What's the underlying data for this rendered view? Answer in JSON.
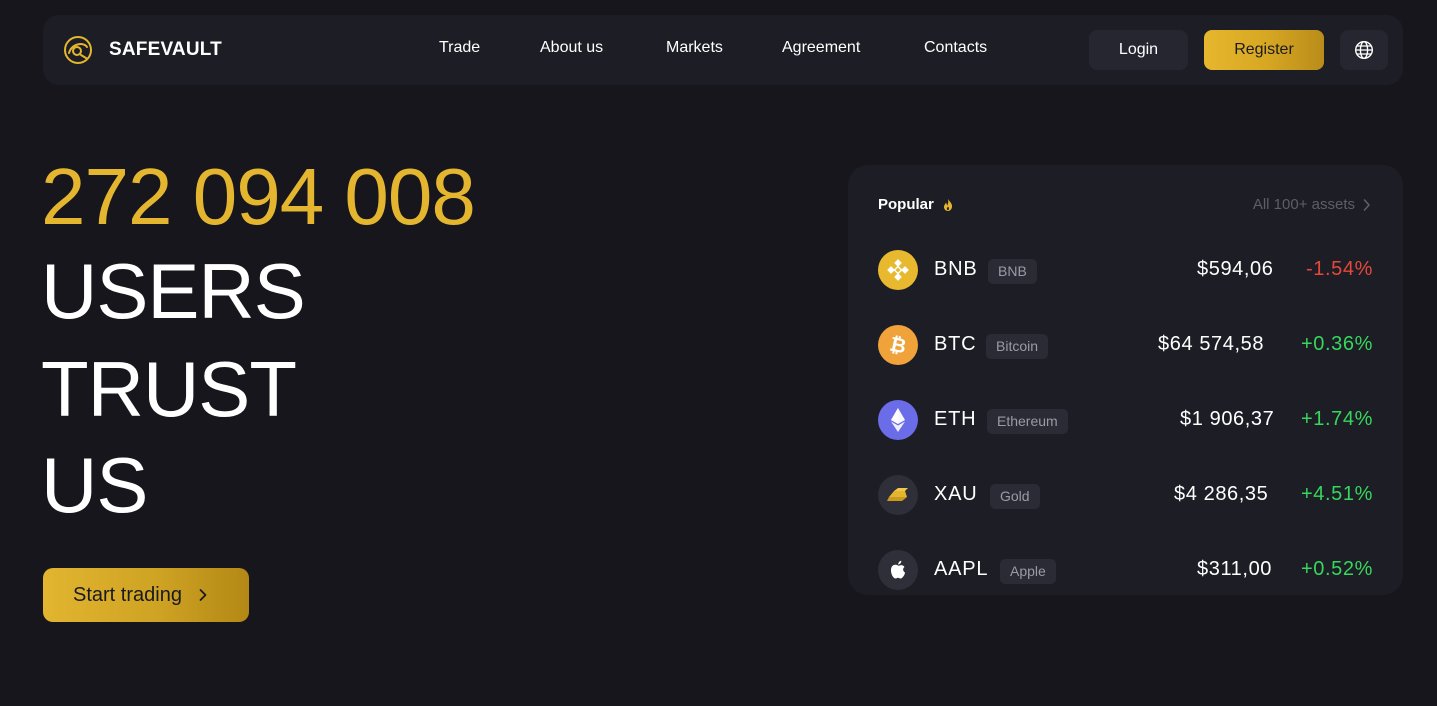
{
  "colors": {
    "accent": "#e4b62f",
    "background": "#16161c",
    "surface": "#1c1d25",
    "positive": "#37d65c",
    "negative": "#e5483a"
  },
  "header": {
    "brand_name": "SAFEVAULT",
    "nav": [
      "Trade",
      "About us",
      "Markets",
      "Agreement",
      "Contacts"
    ],
    "login_label": "Login",
    "register_label": "Register",
    "language_icon": "globe-icon"
  },
  "hero": {
    "count": "272 094 008",
    "line1": "USERS",
    "line2": "TRUST",
    "line3": "US",
    "cta_label": "Start trading"
  },
  "popular": {
    "title": "Popular",
    "all_assets_label": "All 100+ assets",
    "assets": [
      {
        "symbol": "BNB",
        "name": "BNB",
        "price": "$594,06",
        "change": "-1.54%",
        "direction": "down",
        "icon": "bnb-icon"
      },
      {
        "symbol": "BTC",
        "name": "Bitcoin",
        "price": "$64 574,58",
        "change": "+0.36%",
        "direction": "up",
        "icon": "bitcoin-icon"
      },
      {
        "symbol": "ETH",
        "name": "Ethereum",
        "price": "$1 906,37",
        "change": "+1.74%",
        "direction": "up",
        "icon": "ethereum-icon"
      },
      {
        "symbol": "XAU",
        "name": "Gold",
        "price": "$4 286,35",
        "change": "+4.51%",
        "direction": "up",
        "icon": "gold-bars-icon"
      },
      {
        "symbol": "AAPL",
        "name": "Apple",
        "price": "$311,00",
        "change": "+0.52%",
        "direction": "up",
        "icon": "apple-icon"
      }
    ]
  }
}
